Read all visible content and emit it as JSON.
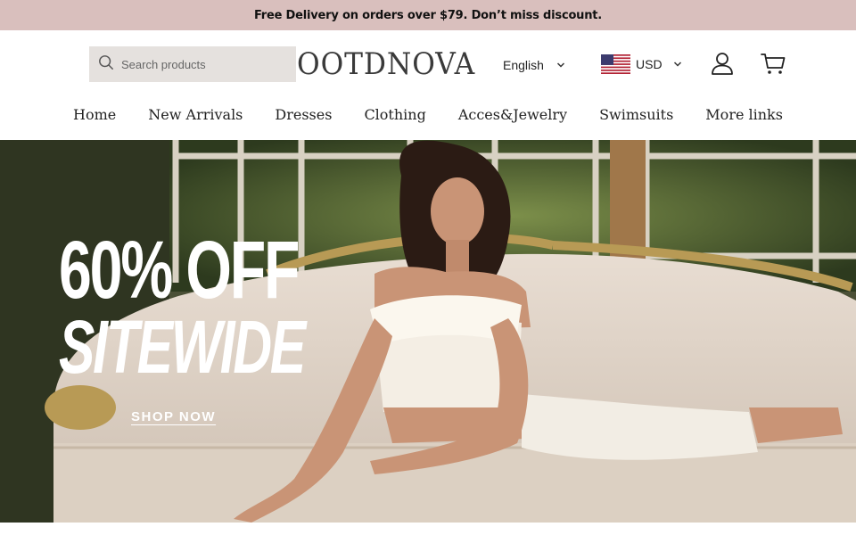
{
  "announcement": "Free Delivery on orders over $79. Don’t miss discount.",
  "search": {
    "placeholder": "Search products"
  },
  "brand": {
    "logo_text": "OOTDNOVA"
  },
  "language": {
    "selected": "English"
  },
  "currency": {
    "selected": "USD",
    "flag": "us-flag-icon"
  },
  "header_icons": [
    "search-icon",
    "user-account-icon",
    "shopping-cart-icon"
  ],
  "nav": {
    "items": [
      "Home",
      "New Arrivals",
      "Dresses",
      "Clothing",
      "Acces&Jewelry",
      "Swimsuits",
      "More links"
    ]
  },
  "hero": {
    "headline_1": "60% OFF",
    "headline_2": "SITEWIDE",
    "cta": "SHOP NOW"
  },
  "colors": {
    "announcement_bg": "#d9bfbd",
    "search_bg": "#e5e1de",
    "text": "#222222"
  }
}
